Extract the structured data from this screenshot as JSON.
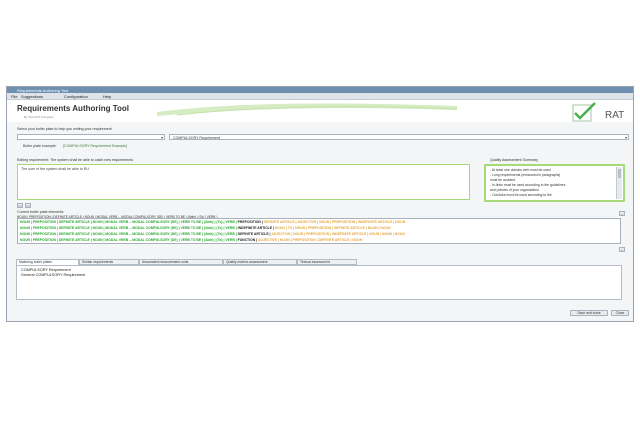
{
  "window": {
    "title": "Requirements Authoring Tool",
    "menu": [
      "File",
      "Suggestions",
      "Configuration",
      "Help"
    ]
  },
  "banner": {
    "app_title": "Requirements Authoring Tool",
    "subtitle": "By The RAT Company",
    "logo_text": "RAT"
  },
  "boilerplate": {
    "select_label": "Select your boiler plate to help you writing your requirement",
    "combo_left_value": "",
    "combo_right_value": "COMPULSORY Requirement",
    "example_label": "Boiler plate example:",
    "example_value": "[COMPULSORY Requirement Example]"
  },
  "editor": {
    "label": "Editing requirement: The system shall be able to catch new requirements",
    "text": "The user of the system shall be able to RU"
  },
  "quality": {
    "title": "Quality Assessment Summary",
    "lines": [
      "- At least one domain verb must be used",
      "- Long requirements (measured in paragraphs)",
      "  must be avoided",
      "- In-links must be used according to the guidelines",
      "  and policies of your organization",
      "- Out-links must be used according to the"
    ]
  },
  "nav": {
    "back": "<<",
    "forward": ">>",
    "expand": "+"
  },
  "elements": {
    "label": "Current boiler plate elements:",
    "header_line": "NOUN | PREPOSITION | DEFINITE ARTICLE | NOUN | MODAL VERB -- MODAL COMPULSORY (DE) | VERB TO BE | (Able) | (To) | VERB )",
    "lines": [
      {
        "green": "NOUN | PREPOSITION | DEFINITE ARTICLE | NOUN | MODAL VERB -- MODAL COMPULSORY (DE) | VERB TO BE | (Able) | (To) | VERB |",
        "dark": " PREPOSITION |",
        "orange": " DEFINITE ARTICLE | ADJECTIVE | NOUN | PREPOSITION | INDEFINITE ARTICLE | NOUN"
      },
      {
        "green": "NOUN | PREPOSITION | DEFINITE ARTICLE | NOUN | MODAL VERB -- MODAL COMPULSORY (DE) | VERB TO BE | (Able) | (To) | VERB |",
        "dark": " INDEFINITE ARTICLE |",
        "orange": " NOUN | TO | NOUN | PREPOSITION | DEFINITE ARTICLE | NOUN | NOUN"
      },
      {
        "green": "NOUN | PREPOSITION | DEFINITE ARTICLE | NOUN | MODAL VERB -- MODAL COMPULSORY (DE) | VERB TO BE | (Able) | (To) | VERB |",
        "dark": " DEFINITE ARTICLE |",
        "orange": " ADJECTIVE | NOUN | PREPOSITION | INDEFINITE ARTICLE | NOUN | NOUN | NOUN"
      },
      {
        "green": "NOUN | PREPOSITION | DEFINITE ARTICLE | NOUN | MODAL VERB -- MODAL COMPULSORY (DE) | VERB TO BE | (Able) | (To) | VERB |",
        "dark": " FUNCTION |",
        "orange": " ADJECTIVE | NOUN | PREPOSITION | DEFINITE ARTICLE | NOUN"
      }
    ]
  },
  "tabs": [
    {
      "label": "Matching boiler plates",
      "active": true
    },
    {
      "label": "Similar requirements",
      "active": false
    },
    {
      "label": "Associated measurement units",
      "active": false
    },
    {
      "label": "Quality metrics assessment",
      "active": false
    },
    {
      "label": "Textual assessment",
      "active": false
    }
  ],
  "matches": [
    "COMPULSORY Requirement",
    "General COMPULSORY Requirement"
  ],
  "buttons": {
    "save_close": "Save and close",
    "close": "Close"
  },
  "colors": {
    "accent_green": "#a6da78",
    "element_green": "#27a82e",
    "element_orange": "#e5a53a",
    "titlebar": "#6e8fb0"
  }
}
